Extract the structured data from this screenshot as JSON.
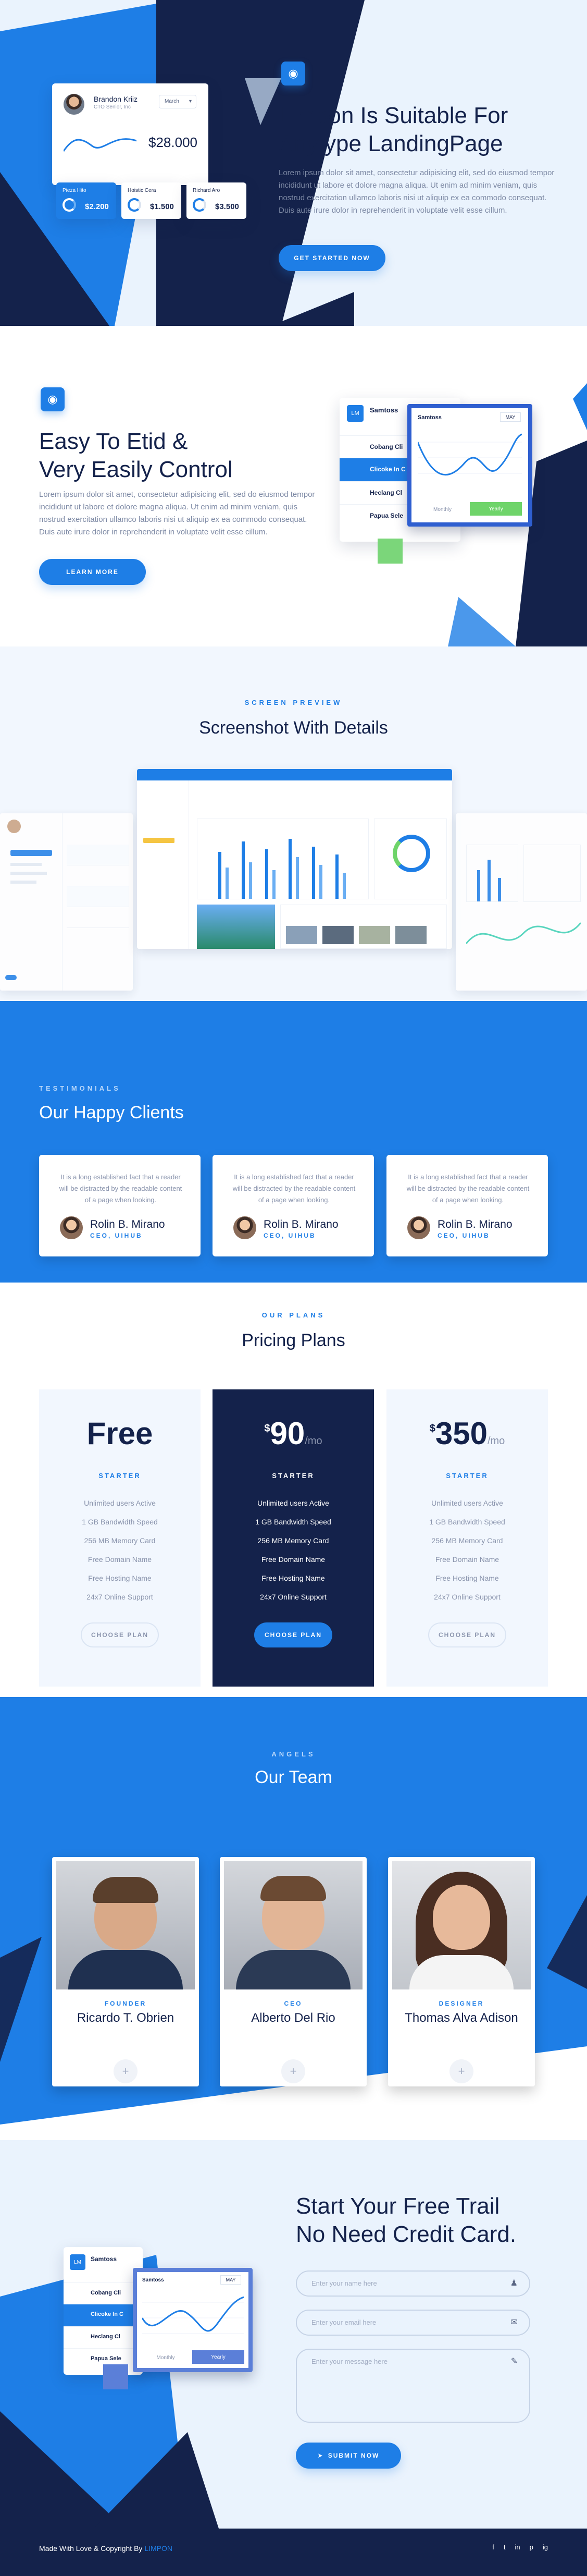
{
  "hero": {
    "title_line1": "Limpon Is Suitable For",
    "title_line2": "Anytype LandingPage",
    "paragraph": "Lorem ipsum dolor sit amet, consectetur adipisicing elit, sed do eiusmod tempor incididunt ut labore et dolore magna aliqua. Ut enim ad minim veniam, quis nostrud exercitation ullamco laboris nisi ut aliquip ex ea commodo consequat. Duis aute irure dolor in reprehenderit in voluptate velit esse cillum.",
    "cta": "GET STARTED NOW",
    "mock": {
      "user_name": "Brandon Kriiz",
      "user_role": "CTO Senior, Inc",
      "month": "March",
      "amount": "$28.000",
      "stat1_label": "Pieza Hito",
      "stat1_value": "$2.200",
      "stat2_label": "Hoistic Cera",
      "stat2_value": "$1.500",
      "stat3_label": "Richard Aro",
      "stat3_value": "$3.500"
    }
  },
  "feature": {
    "title_line1": "Easy To Etid &",
    "title_line2": "Very Easily Control",
    "paragraph": "Lorem ipsum dolor sit amet, consectetur adipisicing elit, sed do eiusmod tempor incididunt ut labore et dolore magna aliqua. Ut enim ad minim veniam, quis nostrud exercitation ullamco laboris nisi ut aliquip ex ea commodo consequat. Duis aute irure dolor in reprehenderit in voluptate velit esse cillum.",
    "cta": "LEARN MORE",
    "mock": {
      "header_name": "Samtoss",
      "list": [
        "Cobang Cli",
        "Clicoke In C",
        "Heclang Cl",
        "Papua Sele"
      ],
      "chart_title": "Samtoss",
      "chart_month": "MAY",
      "tab1": "Monthly",
      "tab2": "Yearly"
    }
  },
  "preview": {
    "eyebrow": "SCREEN PREVIEW",
    "heading": "Screenshot With Details"
  },
  "clients": {
    "eyebrow": "TESTIMONIALS",
    "heading": "Our Happy Clients",
    "items": [
      {
        "text": "It is a long established fact that a reader will be distracted by the readable content of a page when looking.",
        "name": "Rolin B. Mirano",
        "role": "CEO, UIHUB"
      },
      {
        "text": "It is a long established fact that a reader will be distracted by the readable content of a page when looking.",
        "name": "Rolin B. Mirano",
        "role": "CEO, UIHUB"
      },
      {
        "text": "It is a long established fact that a reader will be distracted by the readable content of a page when looking.",
        "name": "Rolin B. Mirano",
        "role": "CEO, UIHUB"
      }
    ]
  },
  "pricing": {
    "eyebrow": "OUR PLANS",
    "heading": "Pricing Plans",
    "plans": [
      {
        "price": "Free",
        "currency": "",
        "period": "",
        "tier": "STARTER",
        "features": [
          "Unlimited users Active",
          "1 GB Bandwidth Speed",
          "256 MB Memory Card",
          "Free Domain Name",
          "Free Hosting Name",
          "24x7 Online Support"
        ],
        "button": "CHOOSE PLAN"
      },
      {
        "price": "90",
        "currency": "$",
        "period": "/mo",
        "tier": "STARTER",
        "features": [
          "Unlimited users Active",
          "1 GB Bandwidth Speed",
          "256 MB Memory Card",
          "Free Domain Name",
          "Free Hosting Name",
          "24x7 Online Support"
        ],
        "button": "CHOOSE PLAN"
      },
      {
        "price": "350",
        "currency": "$",
        "period": "/mo",
        "tier": "STARTER",
        "features": [
          "Unlimited users Active",
          "1 GB Bandwidth Speed",
          "256 MB Memory Card",
          "Free Domain Name",
          "Free Hosting Name",
          "24x7 Online Support"
        ],
        "button": "CHOOSE PLAN"
      }
    ]
  },
  "team": {
    "eyebrow": "ANGELS",
    "heading": "Our Team",
    "members": [
      {
        "role": "FOUNDER",
        "name": "Ricardo T. Obrien"
      },
      {
        "role": "CEO",
        "name": "Alberto Del Rio"
      },
      {
        "role": "DESIGNER",
        "name": "Thomas Alva Adison"
      }
    ]
  },
  "signup": {
    "title_line1": "Start Your Free Trail",
    "title_line2": "No Need Credit Card.",
    "name_placeholder": "Enter your name here",
    "email_placeholder": "Enter your email here",
    "message_placeholder": "Enter your message here",
    "submit": "SUBMIT NOW"
  },
  "footer": {
    "copyright": "Made With Love & Copyright By",
    "brand": "LIMPON",
    "social": [
      "f",
      "t",
      "in",
      "p",
      "ig"
    ]
  },
  "colors": {
    "primary": "#1e7ee6",
    "navy": "#14224b",
    "light": "#f2f7fe"
  }
}
